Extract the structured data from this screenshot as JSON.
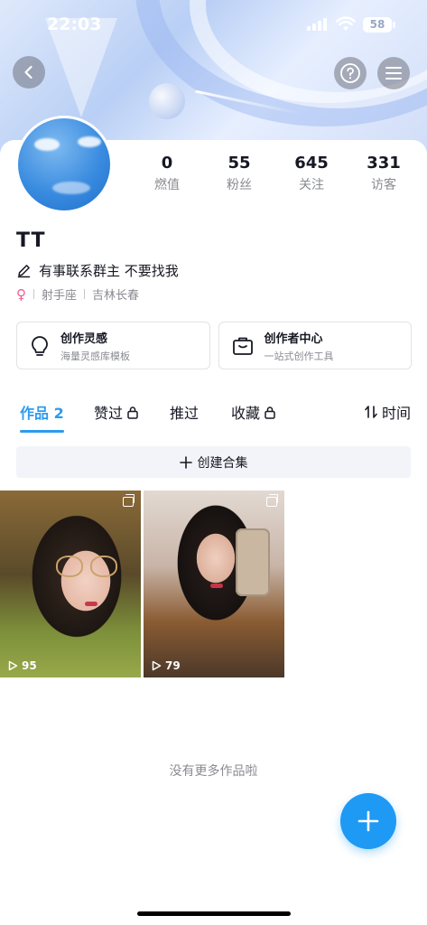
{
  "status_bar": {
    "time": "22:03",
    "battery": "58"
  },
  "profile": {
    "username": "TT",
    "bio": "有事联系群主 不要找我",
    "gender_symbol": "♀",
    "zodiac": "射手座",
    "location": "吉林长春"
  },
  "stats": [
    {
      "value": "0",
      "label": "燃值"
    },
    {
      "value": "55",
      "label": "粉丝"
    },
    {
      "value": "645",
      "label": "关注"
    },
    {
      "value": "331",
      "label": "访客"
    }
  ],
  "tools": [
    {
      "title": "创作灵感",
      "subtitle": "海量灵感库模板",
      "icon": "lightbulb-icon"
    },
    {
      "title": "创作者中心",
      "subtitle": "一站式创作工具",
      "icon": "briefcase-icon"
    }
  ],
  "tabs": [
    {
      "label": "作品 2",
      "active": true
    },
    {
      "label": "赞过",
      "locked": true
    },
    {
      "label": "推过"
    },
    {
      "label": "收藏",
      "locked": true
    },
    {
      "label": "时间",
      "icon": "sort-icon"
    }
  ],
  "collection": {
    "label": "创建合集"
  },
  "posts": [
    {
      "plays": "95"
    },
    {
      "plays": "79"
    }
  ],
  "footer": {
    "no_more": "没有更多作品啦"
  },
  "colors": {
    "accent": "#2b9bf0",
    "fab": "#1e9af5",
    "female": "#f25a8b"
  }
}
